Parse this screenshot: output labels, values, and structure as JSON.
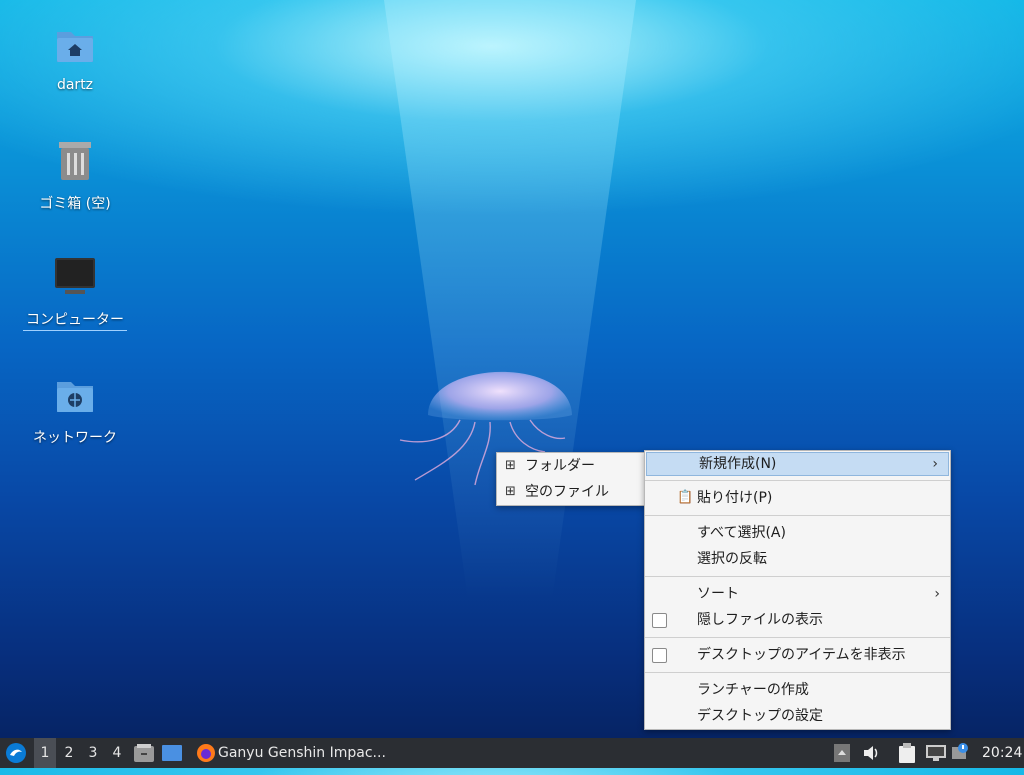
{
  "desktop": {
    "icons": [
      {
        "label": "dartz",
        "icon": "home-folder-icon"
      },
      {
        "label": "ゴミ箱 (空)",
        "icon": "trash-icon"
      },
      {
        "label": "コンピューター",
        "icon": "computer-icon"
      },
      {
        "label": "ネットワーク",
        "icon": "network-folder-icon"
      }
    ]
  },
  "context_menu": {
    "items": [
      {
        "label": "新規作成(N)",
        "has_submenu": true,
        "highlighted": true
      },
      {
        "label": "貼り付け(P)",
        "icon": "clipboard-icon"
      },
      {
        "label": "すべて選択(A)"
      },
      {
        "label": "選択の反転"
      },
      {
        "label": "ソート",
        "has_submenu": true
      },
      {
        "label": "隠しファイルの表示",
        "checkbox": true,
        "checked": false
      },
      {
        "label": "デスクトップのアイテムを非表示",
        "checkbox": true,
        "checked": false
      },
      {
        "label": "ランチャーの作成"
      },
      {
        "label": "デスクトップの設定"
      }
    ],
    "submenu_arrow": "›"
  },
  "submenu": {
    "items": [
      {
        "label": "フォルダー",
        "icon": "add-folder-icon"
      },
      {
        "label": "空のファイル",
        "icon": "add-file-icon"
      }
    ]
  },
  "taskbar": {
    "workspaces": [
      "1",
      "2",
      "3",
      "4"
    ],
    "active_workspace": "1",
    "window_title": "Ganyu Genshin Impac...",
    "clock": "20:24"
  },
  "colors": {
    "menu_highlight": "#c5dcf3",
    "taskbar_bg": "#2b2e33"
  }
}
